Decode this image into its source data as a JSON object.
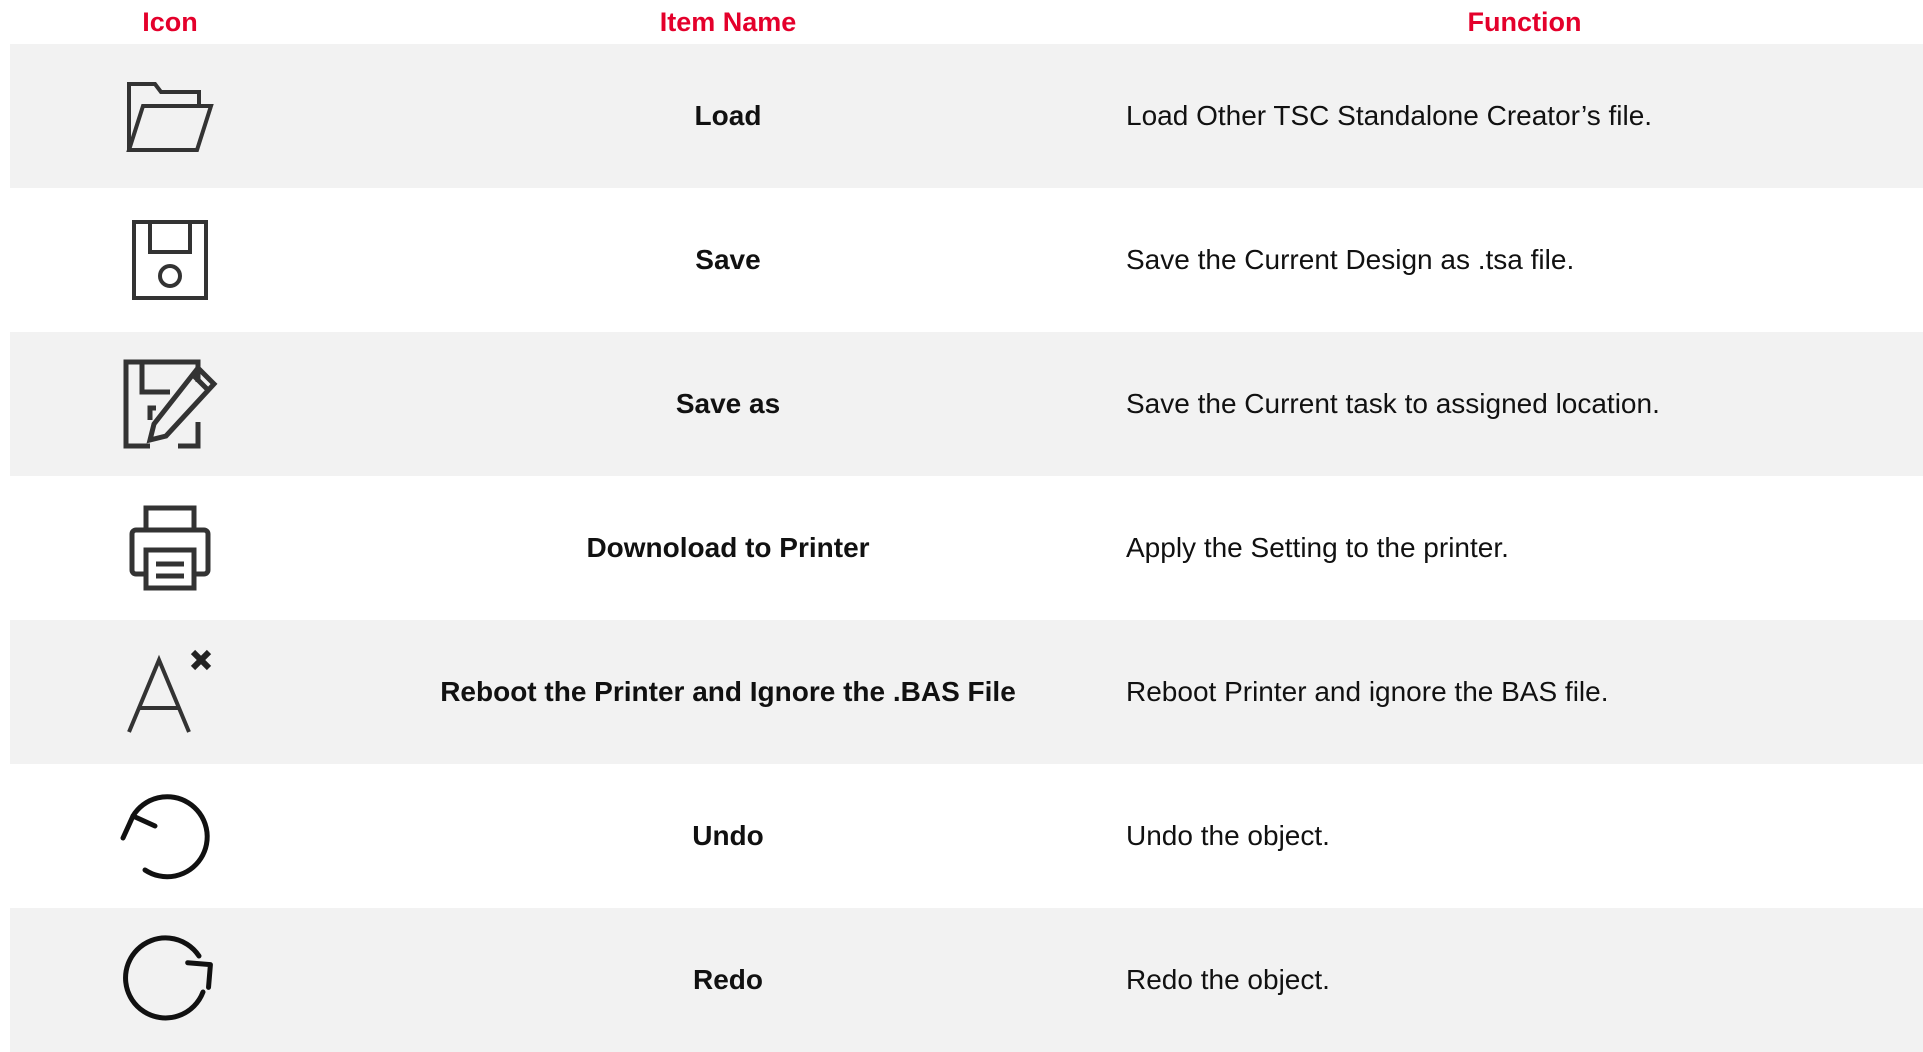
{
  "header": {
    "icon": "Icon",
    "item_name": "Item Name",
    "function": "Function"
  },
  "colors": {
    "header_text": "#e4002b",
    "row_shade": "#f2f2f2",
    "text": "#111111",
    "icon_stroke": "#333333"
  },
  "rows": [
    {
      "icon": "folder-open-icon",
      "name": "Load",
      "function": "Load Other TSC Standalone Creator’s file."
    },
    {
      "icon": "floppy-disk-icon",
      "name": "Save",
      "function": "Save the Current Design as .tsa file."
    },
    {
      "icon": "floppy-disk-edit-icon",
      "name": "Save as",
      "function": "Save the Current task to assigned location."
    },
    {
      "icon": "printer-icon",
      "name": "Downoload to Printer",
      "function": "Apply the Setting to the printer."
    },
    {
      "icon": "font-clear-icon",
      "name": "Reboot the Printer and Ignore the .BAS File",
      "function": "Reboot Printer and ignore the BAS file."
    },
    {
      "icon": "undo-icon",
      "name": "Undo",
      "function": "Undo the object."
    },
    {
      "icon": "redo-icon",
      "name": "Redo",
      "function": "Redo the object."
    }
  ]
}
